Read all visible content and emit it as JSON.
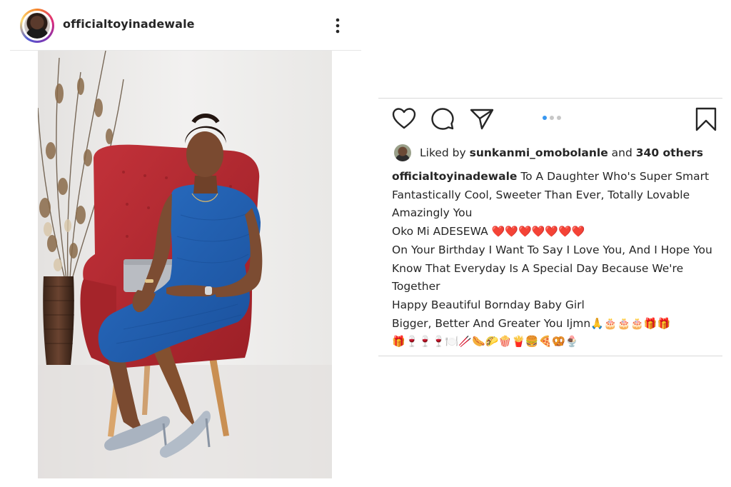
{
  "post": {
    "username": "officialtoyinadewale"
  },
  "icons": {
    "more": "more-vertical-icon",
    "like": "heart-icon",
    "comment": "comment-icon",
    "share": "send-icon",
    "save": "bookmark-icon"
  },
  "colors": {
    "text": "#262626",
    "dress": "#1f5fb4",
    "chair": "#b8282d",
    "heart_emoji": "#d0141c",
    "dot_active": "#3897f0",
    "dot_inactive": "#c7c7c7"
  },
  "carousel": {
    "count": 3,
    "active_index": 0
  },
  "likes": {
    "prefix": "Liked by ",
    "user": "sunkanmi_omobolanle",
    "middle": " and ",
    "others": "340 others"
  },
  "caption": {
    "user": "officialtoyinadewale",
    "line1": " To A Daughter Who's Super Smart",
    "line2": "Fantastically Cool, Sweeter Than Ever, Totally Lovable",
    "line3": "Amazingly You",
    "line4": "Oko Mi ADESEWA ",
    "line4_emoji": "❤️❤️❤️❤️❤️❤️❤️",
    "line5": "On Your Birthday I Want To Say I Love You, And I Hope You",
    "line6": "Know That Everyday Is A Special Day Because We're",
    "line7": "Together",
    "line8": "Happy Beautiful Bornday Baby Girl",
    "line9": "Bigger, Better And Greater You Ijmn",
    "line9_emoji": "🙏🎂🎂🎂🎁🎁",
    "line10_emoji": "🎁🍷🍷🍷🍽️🥢🌭🌮🍿🍟🍔🍕🥨🍨"
  }
}
